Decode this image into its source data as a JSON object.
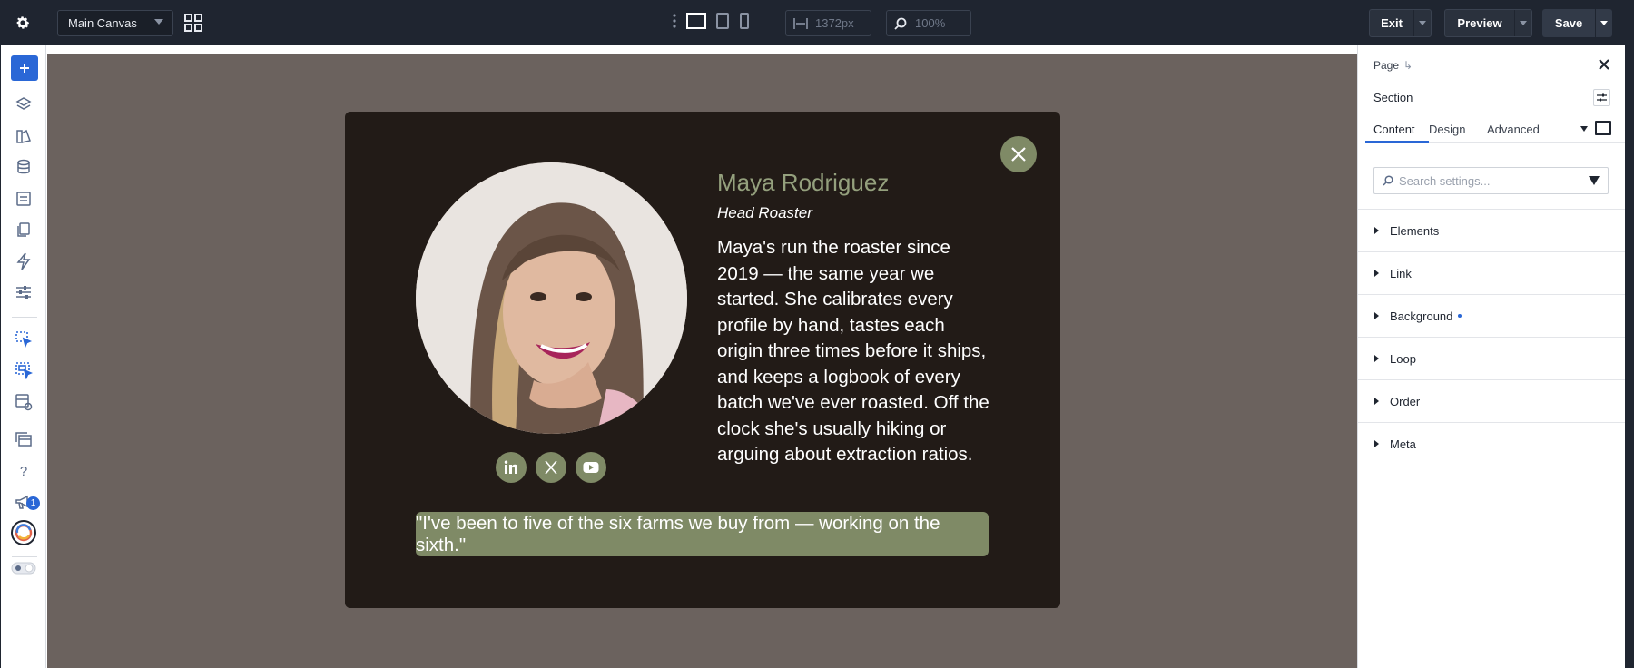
{
  "topbar": {
    "canvas_select": "Main Canvas",
    "width_value": "1372px",
    "zoom_value": "100%",
    "exit_label": "Exit",
    "preview_label": "Preview",
    "save_label": "Save"
  },
  "leftbar": {
    "notification_count": "1",
    "help_label": "?"
  },
  "card": {
    "name": "Maya Rodriguez",
    "role": "Head Roaster",
    "bio": "Maya's run the roaster since 2019 — the same year we started. She calibrates every profile by hand, tastes each origin three times before it ships, and keeps a logbook of every batch we've ever roasted. Off the clock she's usually hiking or arguing about extraction ratios.",
    "quote": "\"I've been to five of the six farms we buy from — working on the sixth.\"",
    "socials": [
      "linkedin-icon",
      "x-icon",
      "youtube-icon"
    ]
  },
  "panel": {
    "breadcrumb": "Page",
    "breadcrumb_arrow": "↳",
    "section_title": "Section",
    "tabs": [
      "Content",
      "Design",
      "Advanced"
    ],
    "search_placeholder": "Search settings...",
    "accordion": [
      "Elements",
      "Link",
      "Background",
      "Loop",
      "Order",
      "Meta"
    ]
  },
  "colors": {
    "topbar_bg": "#1f2530",
    "accent": "#2a67d6",
    "canvas_bg": "#6b625e",
    "card_bg": "#221b17",
    "olive": "#7f8a66",
    "name_color": "#94a07d"
  }
}
